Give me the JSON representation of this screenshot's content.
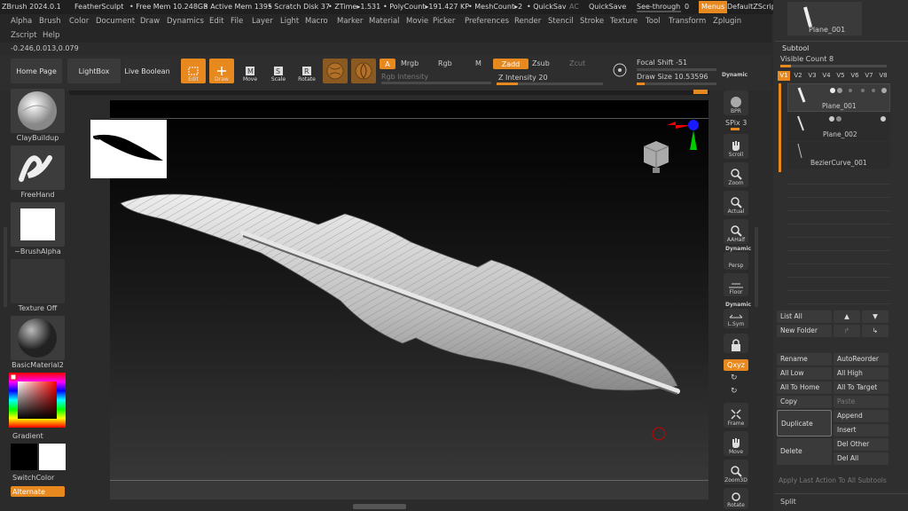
{
  "titlebar": {
    "app": "ZBrush 2024.0.1",
    "doc": "FeatherSculpt",
    "free_mem": "• Free Mem 10.248GB",
    "active_mem": "• Active Mem 1395",
    "scratch": "• Scratch Disk 37",
    "ztime": "• ZTime▸1.531",
    "polycount": "• PolyCount▸191.427 KP",
    "meshcount": "• MeshCount▸2",
    "quicksav": "• QuickSav",
    "ac": "AC",
    "quicksave": "QuickSave",
    "seethrough": "See-through",
    "seethrough_val": "0",
    "menus": "Menus",
    "script": "DefaultZScript"
  },
  "menus": [
    "Alpha",
    "Brush",
    "Color",
    "Document",
    "Draw",
    "Dynamics",
    "Edit",
    "File",
    "Layer",
    "Light",
    "Macro",
    "Marker",
    "Material",
    "Movie",
    "Picker",
    "Preferences",
    "Render",
    "Stencil",
    "Stroke",
    "Texture",
    "Tool",
    "Transform",
    "Zplugin"
  ],
  "menus2": [
    "Zscript",
    "Help"
  ],
  "coords": "-0.246,0.013,0.079",
  "toolbar": {
    "home": "Home Page",
    "lightbox": "LightBox",
    "liveboolean": "Live Boolean",
    "edit": "Edit",
    "draw": "Draw",
    "move": "Move",
    "scale": "Scale",
    "rotate": "Rotate",
    "a": "A",
    "mrgb": "Mrgb",
    "rgb": "Rgb",
    "m": "M",
    "rgb_intensity": "Rgb Intensity",
    "zadd": "Zadd",
    "zsub": "Zsub",
    "zcut": "Zcut",
    "z_intensity": "Z Intensity 20",
    "focal_shift": "Focal Shift -51",
    "draw_size": "Draw Size 10.53596",
    "dynamic": "Dynamic",
    "z_intensity_level": 0.2,
    "draw_size_level": 0.1
  },
  "left": {
    "brush1": "ClayBuildup",
    "brush2": "FreeHand",
    "alpha": "~BrushAlpha",
    "texture": "Texture Off",
    "material": "BasicMaterial2",
    "gradient": "Gradient",
    "switchcolor": "SwitchColor",
    "alternate": "Alternate"
  },
  "vright": {
    "bpr": "BPR",
    "spix": "SPix 3",
    "scroll": "Scroll",
    "zoom": "Zoom",
    "actual": "Actual",
    "aahalf": "AAHalf",
    "dynamic": "Dynamic",
    "persp": "Persp",
    "floor": "Floor",
    "dynamic2": "Dynamic",
    "lsym": "L.Sym",
    "qxyz": "Qxyz",
    "frame": "Frame",
    "move": "Move",
    "zoom3d": "Zoom3D",
    "rotate": "Rotate"
  },
  "subtool": {
    "top_name": "Plane_001",
    "title": "Subtool",
    "visible_count": "Visible Count 8",
    "tabs": [
      "V1",
      "V2",
      "V3",
      "V4",
      "V5",
      "V6",
      "V7",
      "V8"
    ],
    "items": [
      "Plane_001",
      "Plane_002",
      "BezierCurve_001"
    ],
    "buttons": [
      [
        "List All",
        ""
      ],
      [
        "New Folder",
        ""
      ],
      [
        "Rename",
        "AutoReorder"
      ],
      [
        "All Low",
        "All High"
      ],
      [
        "All To Home",
        "All To Target"
      ],
      [
        "Copy",
        "Paste"
      ]
    ],
    "duplicate": "Duplicate",
    "delete": "Delete",
    "append": "Append",
    "insert": "Insert",
    "del_other": "Del Other",
    "del_all": "Del All",
    "apply_last": "Apply Last Action To All Subtools",
    "split": "Split"
  },
  "colors": {
    "accent": "#e8891f",
    "bg": "#2b2b2b"
  }
}
